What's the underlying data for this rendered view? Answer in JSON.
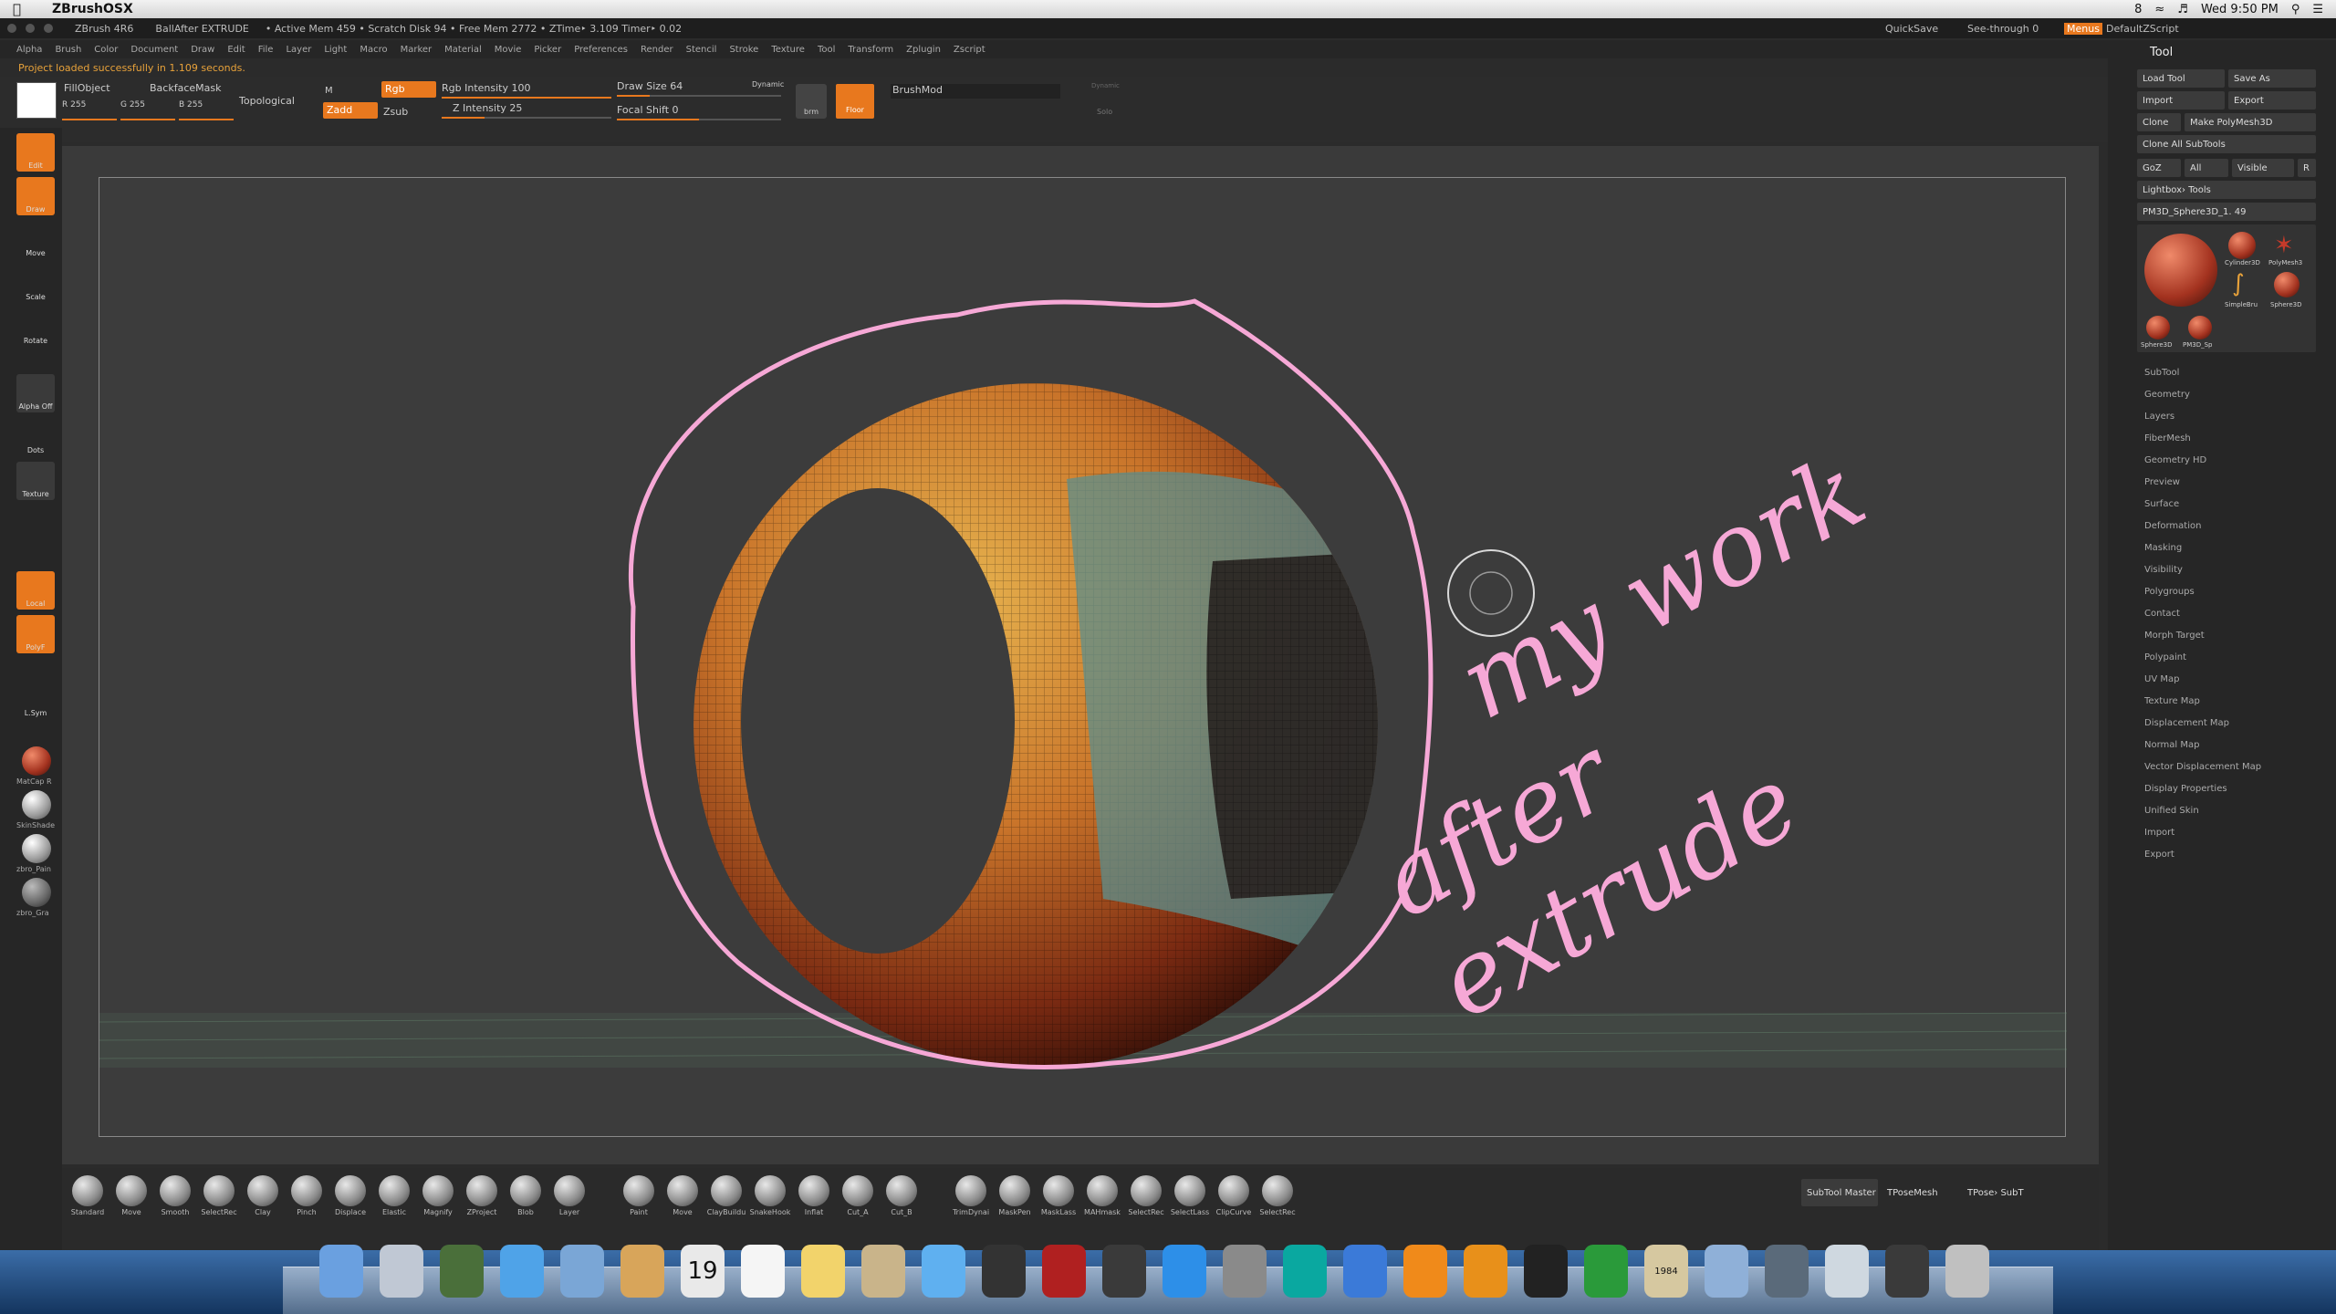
{
  "os_menubar": {
    "apple": "",
    "app_name": "ZBrushOSX",
    "clock": "Wed 9:50 PM",
    "battery_label": "8"
  },
  "titlebar": {
    "app": "ZBrush 4R6",
    "doc": "BallAfter EXTRUDE",
    "stats": "• Active Mem 459 • Scratch Disk 94 • Free Mem 2772 • ZTime‣ 3.109 Timer‣ 0.02",
    "quicksave": "QuickSave",
    "seethrough": "See-through  0",
    "menus": "Menus",
    "script": "DefaultZScript"
  },
  "menus": [
    "Alpha",
    "Brush",
    "Color",
    "Document",
    "Draw",
    "Edit",
    "File",
    "Layer",
    "Light",
    "Macro",
    "Marker",
    "Material",
    "Movie",
    "Picker",
    "Preferences",
    "Render",
    "Stencil",
    "Stroke",
    "Texture",
    "Tool",
    "Transform",
    "Zplugin",
    "Zscript"
  ],
  "status_message": "Project loaded successfully in 1.109 seconds.",
  "toolbar": {
    "fill_object": "FillObject",
    "backface": "BackfaceMask",
    "topological": "Topological",
    "r": "R 255",
    "g": "G 255",
    "b": "B 255",
    "m": "M",
    "rgb": "Rgb",
    "zadd": "Zadd",
    "zsub": "Zsub",
    "rgb_intensity": "Rgb Intensity 100",
    "z_intensity": "Z Intensity 25",
    "draw_size": "Draw Size 64",
    "dynamic": "Dynamic",
    "focal_shift": "Focal Shift 0",
    "brm": "brm",
    "floor": "Floor",
    "brushmod": "BrushMod",
    "solo": "Solo",
    "dynamic2": "Dynamic"
  },
  "left_shelf": {
    "edit": "Edit",
    "draw": "Draw",
    "move": "Move",
    "scale": "Scale",
    "rotate": "Rotate",
    "alpha": "Alpha Off",
    "dots": "Dots",
    "texture": "Texture",
    "local": "Local",
    "polyf": "PolyF",
    "lsym": "L.Sym",
    "matcap": "MatCap R",
    "skinshade": "SkinShade",
    "zbro_pain": "zbro_Pain",
    "zbro_gra": "zbro_Gra"
  },
  "annotation": {
    "line1": "my work",
    "line2": "after extrude"
  },
  "tool_panel": {
    "title": "Tool",
    "load_tool": "Load Tool",
    "save_as": "Save As",
    "import": "Import",
    "export": "Export",
    "clone": "Clone",
    "make_polymesh": "Make PolyMesh3D",
    "clone_all": "Clone All SubTools",
    "goz": "GoZ",
    "all": "All",
    "visible": "Visible",
    "r": "R",
    "lightbox": "Lightbox› Tools",
    "current_tool": "PM3D_Sphere3D_1. 49",
    "thumbs": [
      "Cylinder3D",
      "PolyMesh3",
      "SimpleBru",
      "Sphere3D",
      "Sphere3D",
      "PM3D_Sp"
    ],
    "sections": [
      "SubTool",
      "Geometry",
      "Layers",
      "FiberMesh",
      "Geometry HD",
      "Preview",
      "Surface",
      "Deformation",
      "Masking",
      "Visibility",
      "Polygroups",
      "Contact",
      "Morph Target",
      "Polypaint",
      "UV Map",
      "Texture Map",
      "Displacement Map",
      "Normal Map",
      "Vector Displacement Map",
      "Display Properties",
      "Unified Skin",
      "Import",
      "Export"
    ]
  },
  "bottom_brushes": [
    "Standard",
    "Move",
    "Smooth",
    "SelectRec",
    "Clay",
    "Pinch",
    "Displace",
    "Elastic",
    "Magnify",
    "ZProject",
    "Blob",
    "Layer",
    "Paint",
    "Move",
    "ClayBuildu",
    "SnakeHook",
    "Inflat",
    "Cut_A",
    "Cut_B",
    "TrimDynai",
    "MaskPen",
    "MaskLass",
    "MAHmask",
    "SelectRec",
    "SelectLass",
    "ClipCurve",
    "SelectRec"
  ],
  "bottom_right": {
    "subtool_master": "SubTool Master",
    "tposemesh": "TPoseMesh",
    "tpose_subt": "TPose› SubT"
  },
  "dock": {
    "calendar_day": "19",
    "vlc_label": "",
    "book_label": "1984"
  },
  "colors": {
    "accent": "#e8781e",
    "annotation": "#f6a8d6",
    "sphere_orange": "#d2852a",
    "sphere_teal": "#5e8f8c"
  }
}
